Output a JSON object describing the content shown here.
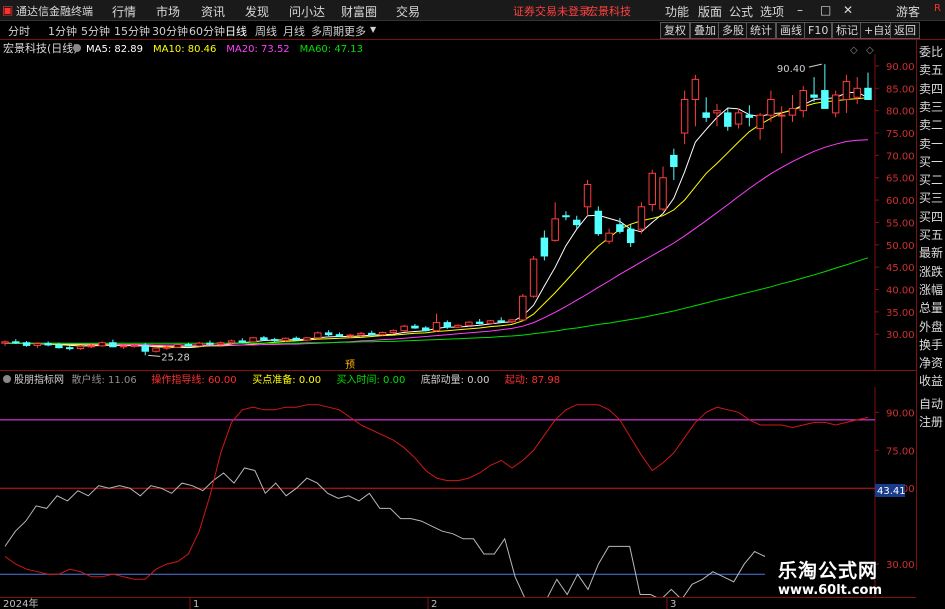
{
  "app": {
    "title": "通达信金融终端",
    "menu": [
      "行情",
      "市场",
      "资讯",
      "发现",
      "问小达",
      "财富圈",
      "交易"
    ],
    "login_status": "证券交易未登录",
    "broker": "宏景科技",
    "right_menu": [
      "功能",
      "版面",
      "公式",
      "选项"
    ],
    "guest": "游客",
    "corner_badge": "R"
  },
  "timeframes": [
    "分时",
    "1分钟",
    "5分钟",
    "15分钟",
    "30分钟",
    "60分钟",
    "日线",
    "周线",
    "月线",
    "多周期",
    "更多"
  ],
  "active_timeframe": "日线",
  "toolbar_right": [
    "复权",
    "叠加",
    "多股",
    "统计",
    "画线",
    "F10",
    "标记",
    "+自选",
    "返回"
  ],
  "main_chart_header": {
    "stock": "宏景科技(日线)",
    "ma": [
      {
        "label": "MA5: 82.89",
        "color": "#ffffff"
      },
      {
        "label": "MA10: 80.46",
        "color": "#ffff00"
      },
      {
        "label": "MA20: 73.52",
        "color": "#ff40ff"
      },
      {
        "label": "MA60: 47.13",
        "color": "#00e000"
      }
    ]
  },
  "sidebar": [
    "委比",
    "卖五",
    "卖四",
    "卖三",
    "卖二",
    "卖一",
    "买一",
    "买二",
    "买三",
    "买四",
    "买五",
    "最新",
    "涨跌",
    "涨幅",
    "总量",
    "外盘",
    "换手",
    "净资",
    "收益",
    "自动",
    "注册"
  ],
  "indicator_header": [
    {
      "label": "股朋指标网",
      "color": "#d0d0d0"
    },
    {
      "label": "散户线: 11.06",
      "color": "#909090"
    },
    {
      "label": "操作指导线: 60.00",
      "color": "#ff3030"
    },
    {
      "label": "买点准备: 0.00",
      "color": "#ffff00"
    },
    {
      "label": "买入时间: 0.00",
      "color": "#00e000"
    },
    {
      "label": "底部动量: 0.00",
      "color": "#d0d0d0"
    },
    {
      "label": "起动: 87.98",
      "color": "#ff3030"
    }
  ],
  "x_labels": [
    "2024年",
    "1",
    "2",
    "3"
  ],
  "marker_text": "预",
  "watermark": {
    "line1": "乐淘公式网",
    "line2": "www.60lt.com"
  },
  "chart_data": [
    {
      "type": "candlestick",
      "title": "宏景科技(日线)",
      "ylim": [
        22,
        92
      ],
      "y_ticks": [
        "90.00",
        "85.00",
        "80.00",
        "75.00",
        "70.00",
        "65.00",
        "60.00",
        "55.00",
        "50.00",
        "45.00",
        "40.00",
        "35.00",
        "30.00"
      ],
      "y_tick_values": [
        90,
        85,
        80,
        75,
        70,
        65,
        60,
        55,
        50,
        45,
        40,
        35,
        30
      ],
      "annotations": [
        {
          "label": "90.40",
          "value": 90.4
        },
        {
          "label": "25.28",
          "value": 25.28
        }
      ],
      "candles": [
        [
          28.0,
          28.6,
          27.4,
          28.3
        ],
        [
          28.3,
          28.9,
          27.8,
          28.1
        ],
        [
          28.1,
          28.5,
          27.2,
          27.5
        ],
        [
          27.5,
          28.2,
          26.9,
          27.9
        ],
        [
          27.9,
          28.4,
          27.3,
          27.6
        ],
        [
          27.6,
          28.1,
          26.8,
          27.0
        ],
        [
          27.0,
          27.6,
          26.4,
          26.8
        ],
        [
          26.8,
          27.5,
          26.5,
          27.3
        ],
        [
          27.3,
          27.9,
          26.9,
          27.4
        ],
        [
          27.4,
          28.4,
          27.2,
          28.1
        ],
        [
          28.1,
          28.8,
          27.1,
          27.2
        ],
        [
          27.2,
          27.7,
          26.7,
          27.4
        ],
        [
          27.4,
          27.9,
          27.0,
          27.5
        ],
        [
          27.5,
          28.0,
          25.3,
          26.2
        ],
        [
          26.2,
          27.2,
          25.9,
          26.9
        ],
        [
          26.9,
          27.6,
          26.5,
          27.1
        ],
        [
          27.1,
          27.9,
          26.9,
          27.7
        ],
        [
          27.7,
          28.1,
          27.2,
          27.4
        ],
        [
          27.4,
          28.3,
          27.2,
          28.0
        ],
        [
          28.0,
          28.6,
          27.5,
          27.8
        ],
        [
          27.8,
          28.4,
          27.4,
          28.1
        ],
        [
          28.1,
          28.8,
          27.7,
          28.5
        ],
        [
          28.5,
          29.1,
          28.0,
          28.3
        ],
        [
          28.3,
          29.4,
          28.1,
          29.2
        ],
        [
          29.2,
          29.6,
          28.5,
          28.8
        ],
        [
          28.8,
          29.2,
          28.2,
          28.6
        ],
        [
          28.6,
          29.3,
          28.3,
          29.1
        ],
        [
          29.1,
          29.5,
          28.5,
          28.7
        ],
        [
          28.7,
          29.4,
          28.4,
          29.2
        ],
        [
          29.2,
          30.6,
          29.0,
          30.3
        ],
        [
          30.3,
          30.9,
          29.6,
          29.9
        ],
        [
          29.9,
          30.4,
          29.4,
          29.6
        ],
        [
          29.6,
          30.1,
          29.1,
          29.8
        ],
        [
          29.8,
          30.5,
          29.5,
          30.2
        ],
        [
          30.2,
          30.8,
          29.8,
          29.9
        ],
        [
          29.9,
          30.6,
          29.7,
          30.4
        ],
        [
          30.4,
          31.1,
          30.1,
          30.8
        ],
        [
          30.8,
          32.1,
          30.6,
          31.8
        ],
        [
          31.8,
          32.3,
          31.2,
          31.4
        ],
        [
          31.4,
          31.8,
          30.6,
          30.8
        ],
        [
          30.8,
          34.6,
          30.5,
          32.6
        ],
        [
          32.6,
          33.1,
          31.2,
          31.6
        ],
        [
          31.6,
          32.2,
          31.4,
          32.0
        ],
        [
          32.0,
          32.9,
          31.7,
          32.7
        ],
        [
          32.7,
          33.4,
          32.2,
          32.4
        ],
        [
          32.4,
          33.2,
          32.1,
          33.0
        ],
        [
          33.0,
          33.8,
          32.6,
          32.8
        ],
        [
          32.8,
          33.4,
          32.4,
          33.2
        ],
        [
          33.2,
          39.0,
          33.0,
          38.5
        ],
        [
          38.5,
          47.5,
          38.2,
          46.8
        ],
        [
          51.5,
          53.2,
          46.5,
          47.5
        ],
        [
          51.0,
          59.5,
          50.7,
          55.8
        ],
        [
          56.5,
          57.5,
          55.5,
          56.4
        ],
        [
          55.5,
          56.5,
          53.5,
          54.5
        ],
        [
          58.5,
          64.5,
          56.5,
          63.5
        ],
        [
          57.5,
          58.6,
          52.0,
          52.5
        ],
        [
          50.8,
          53.6,
          50.2,
          52.6
        ],
        [
          54.5,
          56.0,
          52.5,
          53.0
        ],
        [
          53.5,
          54.6,
          49.5,
          50.5
        ],
        [
          53.5,
          59.5,
          52.5,
          58.5
        ],
        [
          59.0,
          66.8,
          57.5,
          66.0
        ],
        [
          58.0,
          67.5,
          57.5,
          65.0
        ],
        [
          70.0,
          71.5,
          64.5,
          67.5
        ],
        [
          75.0,
          84.5,
          72.5,
          82.5
        ],
        [
          82.5,
          88.0,
          76.5,
          87.0
        ],
        [
          79.5,
          83.0,
          77.5,
          78.5
        ],
        [
          79.5,
          81.5,
          76.5,
          80.0
        ],
        [
          79.5,
          80.5,
          75.5,
          76.5
        ],
        [
          77.0,
          80.5,
          76.0,
          79.5
        ],
        [
          79.0,
          81.2,
          76.5,
          78.5
        ],
        [
          76.0,
          79.5,
          73.5,
          79.0
        ],
        [
          79.0,
          84.5,
          77.5,
          82.5
        ],
        [
          79.0,
          81.0,
          70.5,
          79.0
        ],
        [
          79.0,
          83.5,
          77.5,
          80.5
        ],
        [
          80.0,
          85.5,
          78.5,
          84.5
        ],
        [
          83.5,
          87.5,
          82.0,
          83.0
        ],
        [
          84.5,
          90.4,
          80.5,
          80.5
        ],
        [
          79.5,
          84.5,
          78.5,
          83.5
        ],
        [
          82.5,
          88.0,
          79.5,
          86.5
        ],
        [
          83.0,
          87.5,
          81.5,
          85.0
        ],
        [
          85.0,
          88.5,
          83.5,
          82.5
        ]
      ],
      "series": [
        {
          "name": "MA5",
          "color": "#ffffff",
          "values": [
            28.0,
            28.0,
            27.9,
            27.9,
            27.8,
            27.7,
            27.5,
            27.4,
            27.4,
            27.5,
            27.5,
            27.5,
            27.5,
            27.4,
            27.2,
            27.1,
            27.1,
            27.0,
            27.2,
            27.5,
            27.6,
            27.9,
            28.1,
            28.3,
            28.6,
            28.7,
            28.7,
            28.8,
            28.9,
            29.2,
            29.4,
            29.5,
            29.5,
            29.6,
            29.8,
            29.9,
            30.0,
            30.4,
            30.6,
            30.8,
            31.3,
            31.6,
            31.6,
            31.8,
            32.0,
            32.3,
            32.6,
            32.8,
            34.1,
            36.5,
            40.8,
            45.0,
            49.8,
            53.5,
            56.5,
            56.6,
            55.9,
            55.2,
            53.5,
            52.9,
            55.0,
            57.0,
            60.4,
            66.3,
            73.0,
            75.8,
            78.5,
            80.6,
            80.4,
            79.1,
            78.7,
            79.3,
            79.5,
            80.1,
            81.3,
            82.5,
            82.7,
            82.9,
            84.0,
            84.1,
            82.9
          ]
        },
        {
          "name": "MA10",
          "color": "#ffff00",
          "values": [
            28.0,
            28.0,
            28.0,
            27.9,
            27.9,
            27.8,
            27.7,
            27.7,
            27.6,
            27.6,
            27.6,
            27.5,
            27.4,
            27.4,
            27.4,
            27.3,
            27.3,
            27.3,
            27.3,
            27.4,
            27.4,
            27.5,
            27.6,
            27.8,
            28.0,
            28.2,
            28.4,
            28.5,
            28.7,
            28.9,
            29.0,
            29.1,
            29.2,
            29.3,
            29.5,
            29.7,
            29.8,
            30.0,
            30.2,
            30.3,
            30.6,
            30.8,
            31.0,
            31.2,
            31.4,
            31.7,
            31.9,
            32.2,
            33.0,
            34.5,
            36.9,
            39.3,
            41.9,
            44.6,
            47.3,
            49.7,
            51.6,
            53.5,
            54.6,
            55.4,
            55.9,
            56.5,
            57.8,
            60.0,
            63.0,
            66.0,
            68.2,
            70.6,
            73.0,
            75.3,
            76.9,
            78.3,
            79.5,
            80.2,
            80.9,
            81.6,
            82.0,
            82.2,
            82.5,
            82.7,
            82.9
          ]
        },
        {
          "name": "MA20",
          "color": "#ff40ff",
          "values": [
            28.0,
            28.0,
            28.0,
            28.0,
            28.0,
            28.0,
            27.9,
            27.9,
            27.8,
            27.8,
            27.8,
            27.7,
            27.7,
            27.7,
            27.6,
            27.6,
            27.6,
            27.6,
            27.6,
            27.6,
            27.6,
            27.6,
            27.6,
            27.6,
            27.7,
            27.7,
            27.8,
            27.8,
            27.9,
            28.0,
            28.1,
            28.2,
            28.3,
            28.5,
            28.6,
            28.8,
            28.9,
            29.1,
            29.3,
            29.5,
            29.7,
            29.9,
            30.1,
            30.3,
            30.5,
            30.7,
            31.0,
            31.3,
            31.8,
            32.6,
            33.7,
            34.9,
            36.2,
            37.6,
            39.0,
            40.5,
            41.9,
            43.4,
            44.8,
            46.2,
            47.6,
            49.0,
            50.4,
            52.0,
            53.7,
            55.4,
            57.2,
            59.0,
            60.8,
            62.6,
            64.3,
            65.9,
            67.3,
            68.6,
            69.8,
            70.9,
            71.8,
            72.5,
            73.1,
            73.4,
            73.5
          ]
        },
        {
          "name": "MA60",
          "color": "#00e000",
          "values": [
            28.0,
            28.0,
            28.0,
            28.0,
            28.0,
            28.0,
            28.0,
            28.0,
            28.0,
            28.0,
            28.0,
            28.0,
            28.0,
            28.0,
            28.0,
            28.0,
            28.0,
            28.0,
            28.0,
            28.0,
            28.0,
            28.0,
            28.0,
            28.0,
            28.0,
            28.0,
            28.0,
            28.0,
            28.1,
            28.1,
            28.1,
            28.2,
            28.2,
            28.3,
            28.3,
            28.4,
            28.4,
            28.5,
            28.6,
            28.7,
            28.8,
            28.9,
            29.0,
            29.1,
            29.2,
            29.3,
            29.5,
            29.6,
            29.8,
            30.1,
            30.4,
            30.7,
            31.1,
            31.4,
            31.8,
            32.2,
            32.5,
            32.9,
            33.3,
            33.7,
            34.2,
            34.7,
            35.2,
            35.8,
            36.4,
            37.0,
            37.6,
            38.2,
            38.8,
            39.4,
            40.0,
            40.6,
            41.3,
            41.9,
            42.6,
            43.3,
            44.0,
            44.8,
            45.5,
            46.3,
            47.1
          ]
        }
      ]
    },
    {
      "type": "line",
      "title": "股朋指标网",
      "ylim": [
        17,
        100
      ],
      "y_ticks": [
        "90.00",
        "75.00",
        "60.00",
        "30.00"
      ],
      "y_tick_values": [
        90,
        75,
        60,
        30
      ],
      "current_value_label": "43.41",
      "hlines": [
        {
          "name": "upper",
          "value": 87,
          "color": "#ff40ff"
        },
        {
          "name": "操作指导线",
          "value": 60,
          "color": "#d01818"
        },
        {
          "name": "买点准备",
          "value": 26,
          "color": "#4a7ae0"
        }
      ],
      "series": [
        {
          "name": "散户线",
          "color": "#b8b8b8",
          "values": [
            37,
            43,
            47,
            53,
            52,
            57,
            55,
            59,
            57,
            61,
            60,
            61,
            60,
            57,
            61,
            60,
            58,
            62,
            61,
            59,
            63,
            66,
            62,
            68,
            67,
            58,
            62,
            57,
            60,
            64,
            62,
            58,
            56,
            57,
            55,
            58,
            52,
            52,
            48,
            48,
            47,
            45,
            43,
            42,
            40,
            40,
            34,
            34,
            40,
            25,
            16,
            16,
            16,
            24,
            18,
            26,
            20,
            30,
            37,
            37,
            37,
            18,
            18,
            16,
            20,
            16,
            22,
            24,
            27,
            25,
            23,
            30,
            35,
            33
          ]
        },
        {
          "name": "起动",
          "color": "#d01818",
          "values": [
            33,
            30,
            28,
            27,
            26,
            26,
            28,
            27,
            25,
            25,
            26,
            25,
            24,
            24,
            28,
            30,
            31,
            34,
            43,
            57,
            74,
            86,
            91,
            92,
            91,
            91,
            92,
            92,
            93,
            93,
            92,
            91,
            88,
            85,
            83,
            81,
            79,
            76,
            72,
            67,
            64,
            63,
            63,
            64,
            66,
            69,
            71,
            68,
            71,
            75,
            81,
            87,
            91,
            93,
            93,
            93,
            91,
            87,
            80,
            73,
            67,
            70,
            74,
            80,
            86,
            90,
            92,
            91,
            90,
            87,
            85,
            85,
            85,
            84,
            85,
            86,
            86,
            85,
            86,
            87,
            88
          ]
        }
      ]
    }
  ]
}
